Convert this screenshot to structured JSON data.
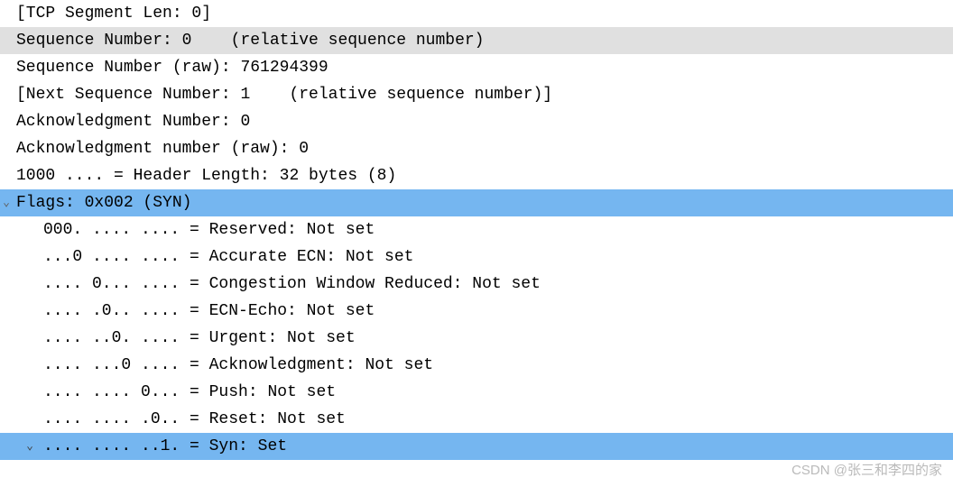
{
  "lines": {
    "segLen": "[TCP Segment Len: 0]",
    "seqNum": "Sequence Number: 0    (relative sequence number)",
    "seqNumRaw": "Sequence Number (raw): 761294399",
    "nextSeq": "[Next Sequence Number: 1    (relative sequence number)]",
    "ackNum": "Acknowledgment Number: 0",
    "ackNumRaw": "Acknowledgment number (raw): 0",
    "headerLen": "1000 .... = Header Length: 32 bytes (8)",
    "flags": "Flags: 0x002 (SYN)",
    "reserved": "000. .... .... = Reserved: Not set",
    "accEcn": "...0 .... .... = Accurate ECN: Not set",
    "cwr": ".... 0... .... = Congestion Window Reduced: Not set",
    "ecnEcho": ".... .0.. .... = ECN-Echo: Not set",
    "urgent": ".... ..0. .... = Urgent: Not set",
    "ack": ".... ...0 .... = Acknowledgment: Not set",
    "push": ".... .... 0... = Push: Not set",
    "reset": ".... .... .0.. = Reset: Not set",
    "syn": ".... .... ..1. = Syn: Set"
  },
  "caret": {
    "down": "⌄"
  },
  "watermark": "CSDN @张三和李四的家"
}
